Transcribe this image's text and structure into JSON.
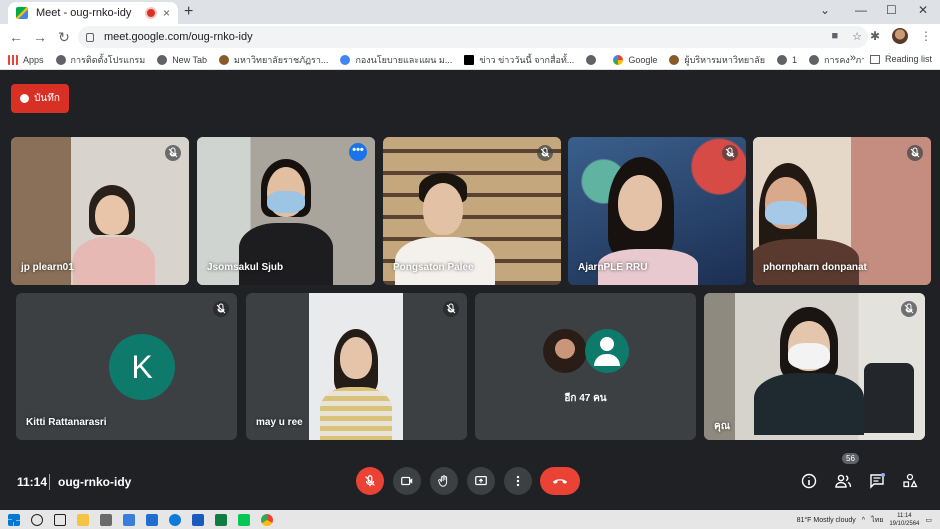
{
  "browser": {
    "tab_title": "Meet - oug-rnko-idy",
    "tab_close": "×",
    "new_tab": "+",
    "url": "meet.google.com/oug-rnko-idy",
    "window_controls": [
      "⌄",
      "—",
      "☐",
      "✕"
    ]
  },
  "bookmarks": {
    "items": [
      {
        "label": "Apps",
        "icon": "apps-grid-icon"
      },
      {
        "label": "การติดตั้งโปรแกรม",
        "icon": "globe-icon"
      },
      {
        "label": "New Tab",
        "icon": "globe-icon"
      },
      {
        "label": "มหาวิทยาลัยราชภัฏรา...",
        "icon": "university-icon"
      },
      {
        "label": "กองนโยบายและแผน ม...",
        "icon": "p-icon"
      },
      {
        "label": "ข่าว ข่าววันนี้ จากสื่อทั้...",
        "icon": "news-icon"
      },
      {
        "label": "",
        "icon": "globe-icon"
      },
      {
        "label": "Google",
        "icon": "google-icon"
      },
      {
        "label": "ผู้บริหารมหาวิทยาลัย",
        "icon": "person-icon"
      },
      {
        "label": "1",
        "icon": "globe-icon"
      },
      {
        "label": "การคงสภาพสิทธิ์การใช้...",
        "icon": "globe-icon"
      }
    ],
    "overflow": "»",
    "reading_list": "Reading list"
  },
  "meet": {
    "record_label": "บันทึก",
    "participants": [
      {
        "name": "jp plearn01",
        "muted": true
      },
      {
        "name": "Jsomsakul Sjub",
        "muted": false,
        "active": true
      },
      {
        "name": "Pongsaton Palee",
        "muted": true
      },
      {
        "name": "AjarnPLE RRU",
        "muted": true
      },
      {
        "name": "phornpharn donpanat",
        "muted": true
      },
      {
        "name": "Kitti Rattanarasri",
        "muted": true,
        "initial": "K"
      },
      {
        "name": "may u ree",
        "muted": true
      },
      {
        "name": "คุณ",
        "muted": true
      }
    ],
    "others_label": "อีก 47 คน",
    "meeting_time": "11:14",
    "meeting_code": "oug-rnko-idy",
    "participant_count": "56"
  },
  "taskbar": {
    "weather": "81°F  Mostly cloudy",
    "lang": "ไทย",
    "time": "11:14",
    "date": "19/10/2564"
  },
  "colors": {
    "meet_bg": "#202124",
    "accent_red": "#ea4335",
    "record_red": "#d93025",
    "avatar_teal": "#0d7a6b",
    "active_blue": "#1a73e8"
  }
}
